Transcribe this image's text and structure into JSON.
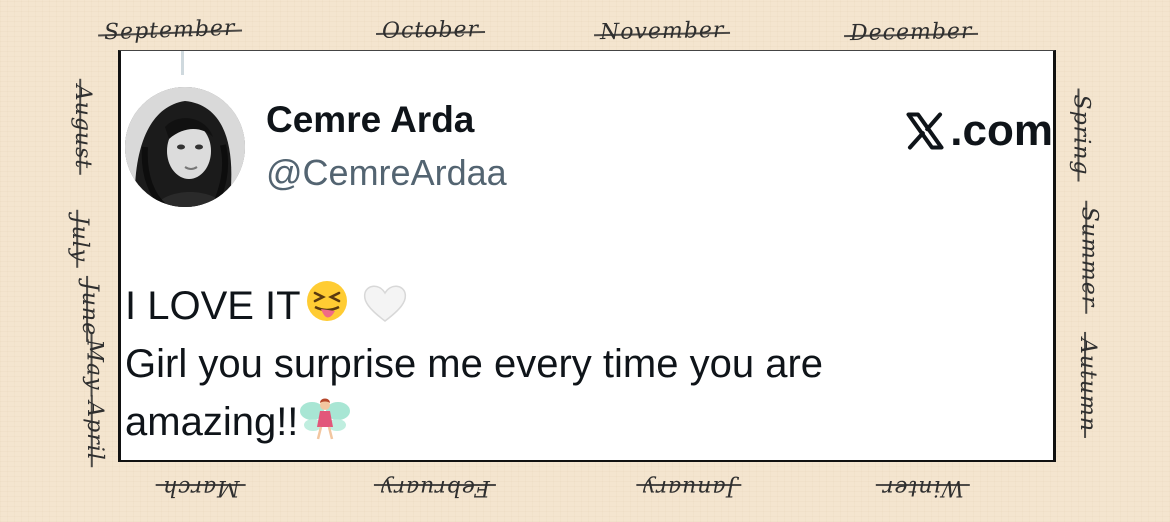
{
  "frame": {
    "months": {
      "top": [
        "September",
        "October",
        "November",
        "December"
      ],
      "bottom": [
        "March",
        "February",
        "January",
        "Winter"
      ],
      "left": [
        "August",
        "July",
        "June",
        "May",
        "April"
      ],
      "right": [
        "Spring",
        "Summer",
        "Autumn"
      ]
    }
  },
  "tweet": {
    "display_name": "Cemre Arda",
    "handle": "@CemreArdaa",
    "brand": ".com",
    "brand_icon": "x-logo-icon",
    "lines": [
      "I LOVE IT",
      "Girl you surprise me every time you are",
      "amazing!!"
    ],
    "emojis": [
      "squinting-tongue-emoji",
      "white-heart-emoji",
      "fairy-emoji"
    ]
  },
  "colors": {
    "background": "#f4e5cf",
    "card": "#ffffff",
    "name": "#0f1419",
    "handle": "#536471"
  }
}
